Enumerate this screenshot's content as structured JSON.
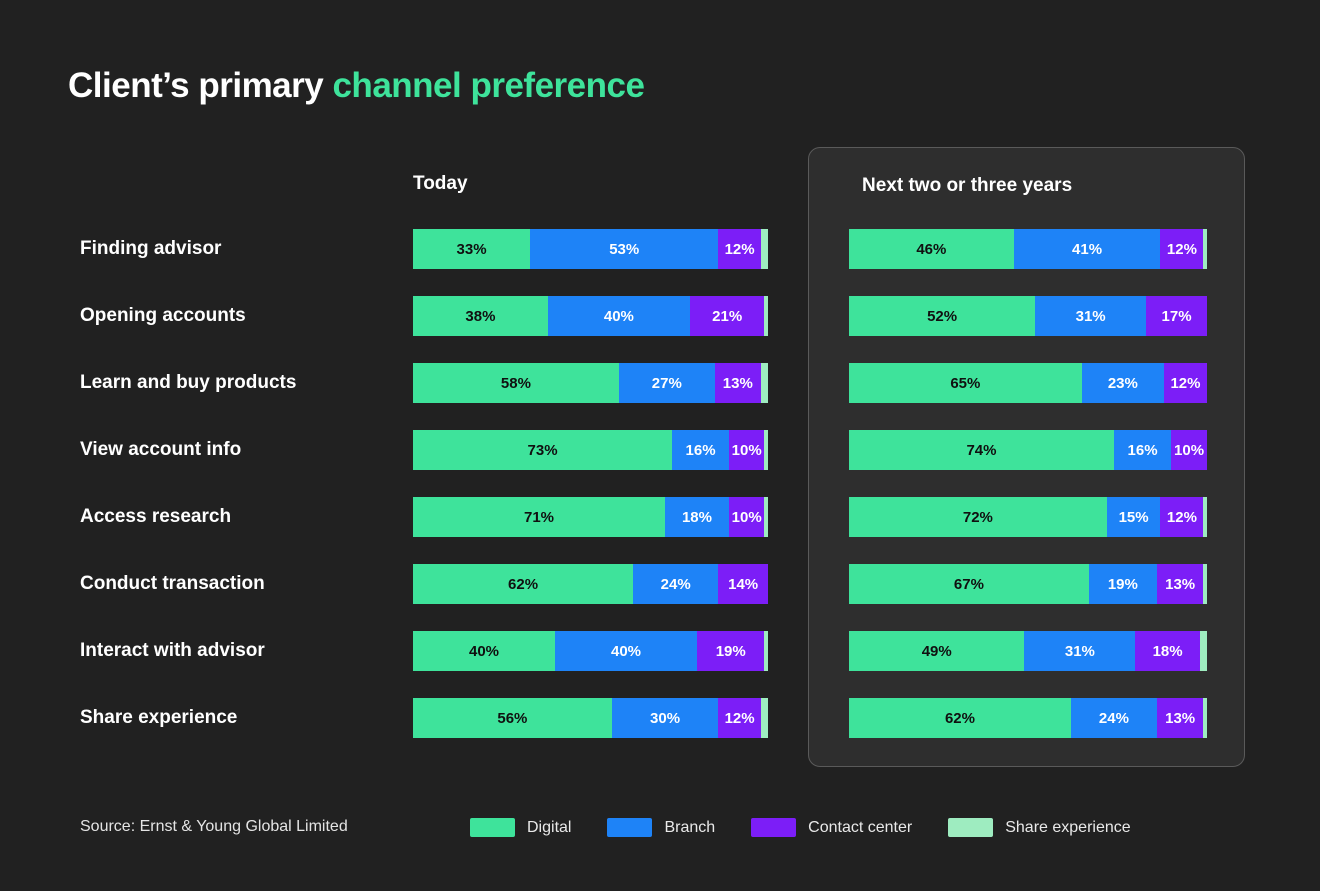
{
  "title": {
    "prefix": "Client’s primary ",
    "accent": "channel preference"
  },
  "columns": {
    "today_label": "Today",
    "future_label": "Next two or three years"
  },
  "source": "Source: Ernst & Young Global Limited",
  "legend": [
    {
      "label": "Digital",
      "color": "#3EE39B",
      "icon": "legend-swatch-digital"
    },
    {
      "label": "Branch",
      "color": "#1E83F7",
      "icon": "legend-swatch-branch"
    },
    {
      "label": "Contact center",
      "color": "#7C1EF7",
      "icon": "legend-swatch-contact-center"
    },
    {
      "label": "Share experience",
      "color": "#9EECC0",
      "icon": "legend-swatch-share-experience"
    }
  ],
  "colors": {
    "background": "#212121",
    "panel_background": "#2E2E2E",
    "panel_border": "#5A5A5A",
    "accent": "#3EE39B",
    "digital": "#3EE39B",
    "branch": "#1E83F7",
    "contact_center": "#7C1EF7",
    "share_experience": "#9EECC0",
    "text": "#FFFFFF"
  },
  "rows": [
    {
      "label": "Finding advisor",
      "today": {
        "digital": "33%",
        "branch": "53%",
        "contact": "12%",
        "share": "2%"
      },
      "future": {
        "digital": "46%",
        "branch": "41%",
        "contact": "12%",
        "share": "1%"
      }
    },
    {
      "label": "Opening accounts",
      "today": {
        "digital": "38%",
        "branch": "40%",
        "contact": "21%",
        "share": "1%"
      },
      "future": {
        "digital": "52%",
        "branch": "31%",
        "contact": "17%",
        "share": "0%"
      }
    },
    {
      "label": "Learn and buy products",
      "today": {
        "digital": "58%",
        "branch": "27%",
        "contact": "13%",
        "share": "2%"
      },
      "future": {
        "digital": "65%",
        "branch": "23%",
        "contact": "12%",
        "share": "0%"
      }
    },
    {
      "label": "View account info",
      "today": {
        "digital": "73%",
        "branch": "16%",
        "contact": "10%",
        "share": "1%"
      },
      "future": {
        "digital": "74%",
        "branch": "16%",
        "contact": "10%",
        "share": "0%"
      }
    },
    {
      "label": "Access research",
      "today": {
        "digital": "71%",
        "branch": "18%",
        "contact": "10%",
        "share": "1%"
      },
      "future": {
        "digital": "72%",
        "branch": "15%",
        "contact": "12%",
        "share": "1%"
      }
    },
    {
      "label": "Conduct transaction",
      "today": {
        "digital": "62%",
        "branch": "24%",
        "contact": "14%",
        "share": "0%"
      },
      "future": {
        "digital": "67%",
        "branch": "19%",
        "contact": "13%",
        "share": "1%"
      }
    },
    {
      "label": "Interact with advisor",
      "today": {
        "digital": "40%",
        "branch": "40%",
        "contact": "19%",
        "share": "1%"
      },
      "future": {
        "digital": "49%",
        "branch": "31%",
        "contact": "18%",
        "share": "2%"
      }
    },
    {
      "label": "Share experience",
      "today": {
        "digital": "56%",
        "branch": "30%",
        "contact": "12%",
        "share": "2%"
      },
      "future": {
        "digital": "62%",
        "branch": "24%",
        "contact": "13%",
        "share": "1%"
      }
    }
  ],
  "chart_data": {
    "type": "bar",
    "title": "Client’s primary channel preference",
    "subtitle": "",
    "orientation": "horizontal",
    "stacked": true,
    "stacked_100": true,
    "xlabel": "",
    "ylabel": "",
    "xlim": [
      0,
      100
    ],
    "grid": false,
    "legend_position": "bottom",
    "panels": [
      "Today",
      "Next two or three years"
    ],
    "categories": [
      "Finding advisor",
      "Opening accounts",
      "Learn and buy products",
      "View account info",
      "Access research",
      "Conduct transaction",
      "Interact with advisor",
      "Share experience"
    ],
    "series": [
      {
        "name": "Digital",
        "panel": "Today",
        "values": [
          33,
          38,
          58,
          73,
          71,
          62,
          40,
          56
        ]
      },
      {
        "name": "Branch",
        "panel": "Today",
        "values": [
          53,
          40,
          27,
          16,
          18,
          24,
          40,
          30
        ]
      },
      {
        "name": "Contact center",
        "panel": "Today",
        "values": [
          12,
          21,
          13,
          10,
          10,
          14,
          19,
          12
        ]
      },
      {
        "name": "Share experience",
        "panel": "Today",
        "values": [
          2,
          1,
          2,
          1,
          1,
          0,
          1,
          2
        ]
      },
      {
        "name": "Digital",
        "panel": "Next two or three years",
        "values": [
          46,
          52,
          65,
          74,
          72,
          67,
          49,
          62
        ]
      },
      {
        "name": "Branch",
        "panel": "Next two or three years",
        "values": [
          41,
          31,
          23,
          16,
          15,
          19,
          31,
          24
        ]
      },
      {
        "name": "Contact center",
        "panel": "Next two or three years",
        "values": [
          12,
          17,
          12,
          10,
          12,
          13,
          18,
          13
        ]
      },
      {
        "name": "Share experience",
        "panel": "Next two or three years",
        "values": [
          1,
          0,
          0,
          0,
          1,
          1,
          2,
          1
        ]
      }
    ],
    "annotations": [
      "Source: Ernst & Young Global Limited"
    ]
  }
}
